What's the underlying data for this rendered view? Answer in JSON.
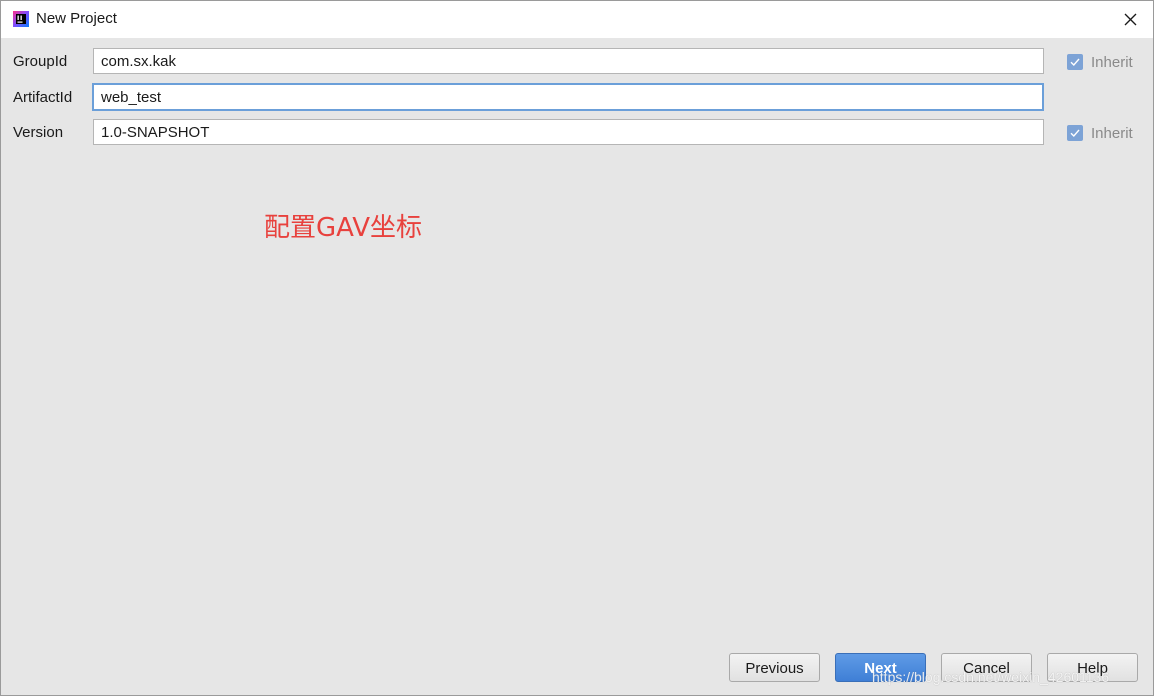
{
  "window": {
    "title": "New Project",
    "icon": "intellij-idea-icon",
    "close_icon": "close-icon"
  },
  "form": {
    "groupid": {
      "label": "GroupId",
      "value": "com.sx.kak",
      "inherit_label": "Inherit",
      "inherit_checked": true
    },
    "artifactid": {
      "label": "ArtifactId",
      "value": "web_test"
    },
    "version": {
      "label": "Version",
      "value": "1.0-SNAPSHOT",
      "inherit_label": "Inherit",
      "inherit_checked": true
    }
  },
  "annotation": {
    "text": "配置GAV坐标",
    "color": "#e8413d"
  },
  "footer": {
    "previous_label": "Previous",
    "next_label": "Next",
    "cancel_label": "Cancel",
    "help_label": "Help"
  },
  "watermark": {
    "text": "https://blog.csdn.net/weixin_42601136"
  },
  "colors": {
    "accent": "#4a8ae0",
    "background": "#e6e6e6",
    "focus_border": "#6b9fd9"
  }
}
